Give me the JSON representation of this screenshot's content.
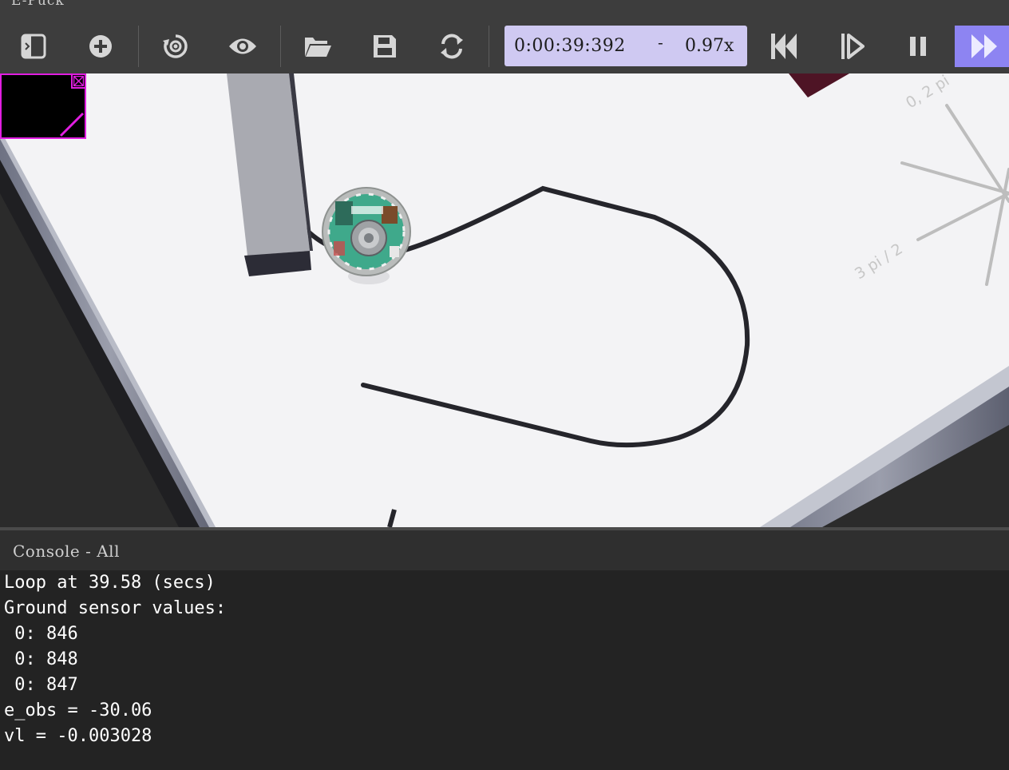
{
  "window": {
    "title": "E-Puck"
  },
  "toolbar": {
    "buttons": [
      {
        "name": "toggle-scene-tree",
        "icon": "sidebar-toggle-icon"
      },
      {
        "name": "add-node",
        "icon": "add-circle-icon"
      },
      {
        "name": "reset-view",
        "icon": "rotate-view-icon"
      },
      {
        "name": "view-options",
        "icon": "eye-icon"
      },
      {
        "name": "open-world",
        "icon": "folder-open-icon"
      },
      {
        "name": "save-world",
        "icon": "save-icon"
      },
      {
        "name": "reload-world",
        "icon": "reload-icon"
      },
      {
        "name": "reset-simulation",
        "icon": "skip-back-icon"
      },
      {
        "name": "step",
        "icon": "step-icon"
      },
      {
        "name": "pause",
        "icon": "pause-icon"
      },
      {
        "name": "fast-forward",
        "icon": "fast-forward-icon"
      }
    ],
    "simulation_time": "0:00:39:392",
    "time_separator": "-",
    "speed": "0.97x"
  },
  "view3d": {
    "compass_labels": [
      "0, 2 pi",
      "3 pi / 2"
    ]
  },
  "console": {
    "title": "Console - All",
    "lines": [
      "Loop at 39.58 (secs)",
      "Ground sensor values:",
      " 0: 846",
      " 0: 848",
      " 0: 847",
      "e_obs = -30.06",
      "vl = -0.003028"
    ]
  },
  "colors": {
    "toolbar_bg": "#3d3d3d",
    "time_box": "#cfc9f2",
    "fast_forward_active": "#8d84f2",
    "overlay_border": "#e11ee1",
    "console_bg": "#232323"
  }
}
